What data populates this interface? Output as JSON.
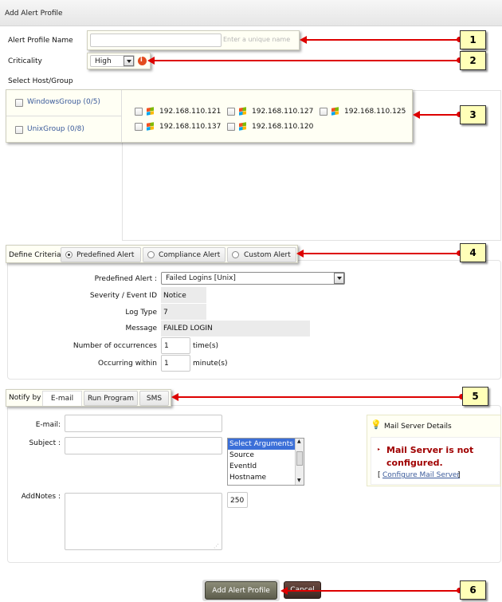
{
  "header": {
    "title": "Add Alert Profile"
  },
  "form": {
    "profile_name_label": "Alert Profile Name",
    "profile_name_placeholder": "Enter a unique name",
    "criticality_label": "Criticality",
    "criticality_value": "High",
    "select_host_label": "Select Host/Group"
  },
  "groups": [
    {
      "label": "WindowsGroup (0/5)"
    },
    {
      "label": "UnixGroup (0/8)"
    }
  ],
  "hosts": [
    {
      "label": "192.168.110.121"
    },
    {
      "label": "192.168.110.127"
    },
    {
      "label": "192.168.110.125"
    },
    {
      "label": "192.168.110.137"
    },
    {
      "label": "192.168.110.120"
    }
  ],
  "criteria": {
    "label": "Define Criteria",
    "options": [
      "Predefined Alert",
      "Compliance Alert",
      "Custom Alert"
    ],
    "selected": "Predefined Alert",
    "predefined_alert_label": "Predefined Alert :",
    "predefined_alert_value": "Failed Logins [Unix]",
    "severity_label": "Severity / Event ID",
    "severity_value": "Notice",
    "log_type_label": "Log Type",
    "log_type_value": "7",
    "message_label": "Message",
    "message_value": "FAILED LOGIN",
    "occurrences_label": "Number of occurrences",
    "occurrences_value": "1",
    "occurrences_unit": "time(s)",
    "within_label": "Occurring within",
    "within_value": "1",
    "within_unit": "minute(s)"
  },
  "notify": {
    "label": "Notify by",
    "tabs": [
      "E-mail",
      "Run Program",
      "SMS"
    ],
    "email_label": "E-mail:",
    "subject_label": "Subject :",
    "arguments": [
      "Select Arguments",
      "Source",
      "EventId",
      "Hostname"
    ],
    "addnotes_label": "AddNotes :",
    "addnotes_limit": "250"
  },
  "mail_server": {
    "title": "Mail Server Details",
    "warning": "Mail Server is not configured.",
    "configure_prefix": "[",
    "configure_link": "Configure Mail Server",
    "configure_suffix": "]"
  },
  "actions": {
    "add": "Add Alert Profile",
    "cancel": "Cancel"
  },
  "callouts": [
    "1",
    "2",
    "3",
    "4",
    "5",
    "6"
  ],
  "colors": {
    "callout_fill": "#ffffb8",
    "arrow": "#dd0000",
    "warning_text": "#a00000",
    "link": "#3a5a9a"
  }
}
